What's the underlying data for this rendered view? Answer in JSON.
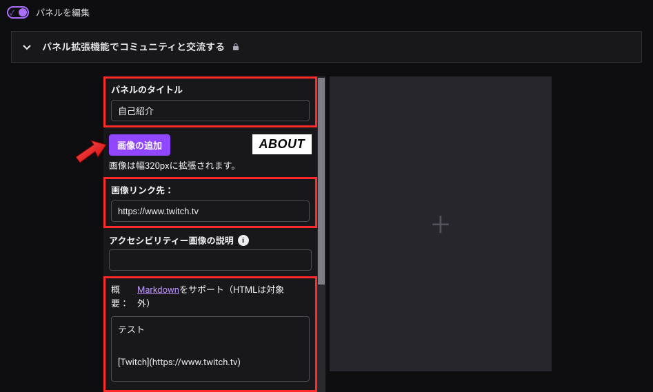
{
  "header": {
    "edit_panels_label": "パネルを編集"
  },
  "expander": {
    "title": "パネル拡張機能でコミュニティと交流する"
  },
  "panel": {
    "title_label": "パネルのタイトル",
    "title_value": "自己紹介",
    "add_image_label": "画像の追加",
    "about_badge": "ABOUT",
    "image_hint": "画像は幅320pxに拡張されます。",
    "image_link_label": "画像リンク先：",
    "image_link_value": "https://www.twitch.tv",
    "a11y_label": "アクセシビリティー画像の説明",
    "a11y_value": "",
    "desc_left1": "概",
    "desc_left2": "要：",
    "markdown_link": "Markdown",
    "desc_right_suffix1": "をサポート（HTMLは対象",
    "desc_right_suffix2": "外）",
    "desc_value": "テスト\n\n[Twitch](https://www.twitch.tv)"
  }
}
